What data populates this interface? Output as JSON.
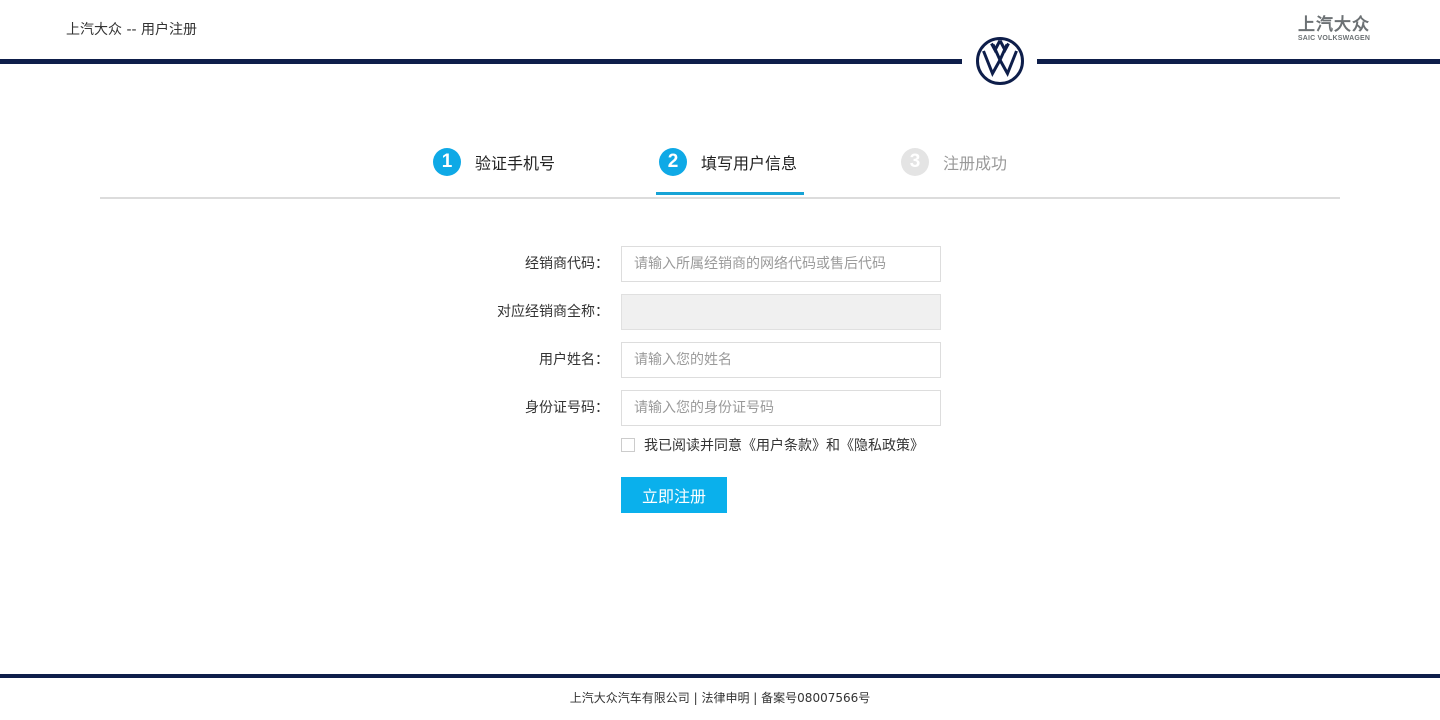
{
  "header": {
    "title": "上汽大众 -- 用户注册",
    "brand_cn": "上汽大众",
    "brand_en": "SAIC VOLKSWAGEN",
    "rule_color": "#0e1e4a"
  },
  "steps": [
    {
      "number": "1",
      "label": "验证手机号",
      "state": "done"
    },
    {
      "number": "2",
      "label": "填写用户信息",
      "state": "active"
    },
    {
      "number": "3",
      "label": "注册成功",
      "state": "pending"
    }
  ],
  "form": {
    "dealer_code": {
      "label": "经销商代码：",
      "value": "",
      "placeholder": "请输入所属经销商的网络代码或售后代码"
    },
    "dealer_name": {
      "label": "对应经销商全称：",
      "value": "",
      "placeholder": ""
    },
    "user_name": {
      "label": "用户姓名：",
      "value": "",
      "placeholder": "请输入您的姓名"
    },
    "id_number": {
      "label": "身份证号码：",
      "value": "",
      "placeholder": "请输入您的身份证号码"
    },
    "agreement": {
      "checked": false,
      "text": "我已阅读并同意《用户条款》和《隐私政策》"
    },
    "submit_label": "立即注册"
  },
  "footer": {
    "company": "上汽大众汽车有限公司",
    "separator": "|",
    "legal": "法律申明",
    "icp": "备案号08007566号"
  },
  "colors": {
    "accent": "#0ab0ec",
    "step_active": "#0fa9e6",
    "step_pending": "#e4e4e4",
    "navy": "#0e1e4a"
  }
}
